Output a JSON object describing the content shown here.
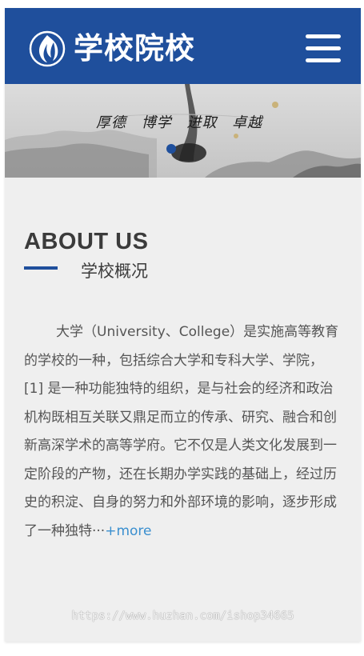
{
  "header": {
    "logo_text": "学校院校",
    "logo_icon": "flame-logo-icon",
    "menu_icon": "hamburger-menu-icon",
    "background_color": "#1f4f9c"
  },
  "banner": {
    "calligraphy_text": "厚德 博学 进取 卓越",
    "active_slide": 1
  },
  "about": {
    "title": "ABOUT US",
    "subtitle": "学校概况",
    "body": "大学（University、College）是实施高等教育的学校的一种，包括综合大学和专科大学、学院， [1] 是一种功能独特的组织，是与社会的经济和政治机构既相互关联又鼎足而立的传承、研究、融合和创新高深学术的高等学府。它不仅是人类文化发展到一定阶段的产物，还在长期办学实践的基础上，经过历史的积淀、自身的努力和外部环境的影响，逐步形成了一种独特···",
    "more_label": "+more",
    "accent_color": "#1f4f9c",
    "link_color": "#3a8fcf"
  },
  "watermark": {
    "text": "https://www.huzhan.com/ishop34665"
  }
}
